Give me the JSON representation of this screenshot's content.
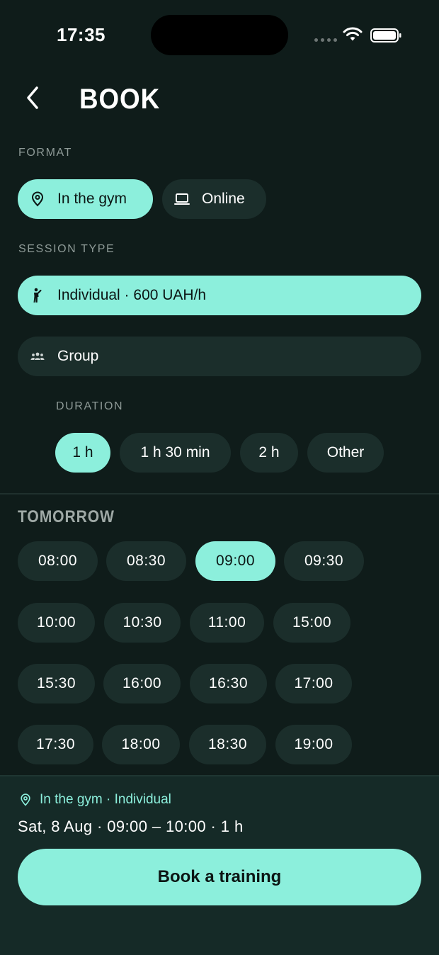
{
  "status_bar": {
    "time": "17:35"
  },
  "header": {
    "title": "BOOK"
  },
  "format": {
    "label": "FORMAT",
    "options": [
      {
        "label": "In the gym",
        "icon": "location-pin-icon",
        "selected": true
      },
      {
        "label": "Online",
        "icon": "laptop-icon",
        "selected": false
      }
    ]
  },
  "session_type": {
    "label": "SESSION TYPE",
    "options": [
      {
        "label": "Individual · 600 UAH/h",
        "icon": "person-icon",
        "selected": true
      },
      {
        "label": "Group",
        "icon": "group-icon",
        "selected": false
      }
    ]
  },
  "duration": {
    "label": "DURATION",
    "options": [
      {
        "label": "1 h",
        "selected": true
      },
      {
        "label": "1 h 30 min",
        "selected": false
      },
      {
        "label": "2 h",
        "selected": false
      },
      {
        "label": "Other",
        "selected": false
      }
    ]
  },
  "schedule": {
    "day_label": "TOMORROW",
    "slots": [
      "08:00",
      "08:30",
      "09:00",
      "09:30",
      "10:00",
      "10:30",
      "11:00",
      "15:00",
      "15:30",
      "16:00",
      "16:30",
      "17:00",
      "17:30",
      "18:00",
      "18:30",
      "19:00"
    ],
    "selected": "09:00"
  },
  "summary": {
    "location_line": "In the gym · Individual",
    "detail": "Sat, 8 Aug · 09:00 – 10:00 · 1 h",
    "book_label": "Book a training"
  },
  "colors": {
    "background": "#0f1c1a",
    "accent": "#8cefdc",
    "chip": "#1b2e2b",
    "panel": "#152a27"
  }
}
